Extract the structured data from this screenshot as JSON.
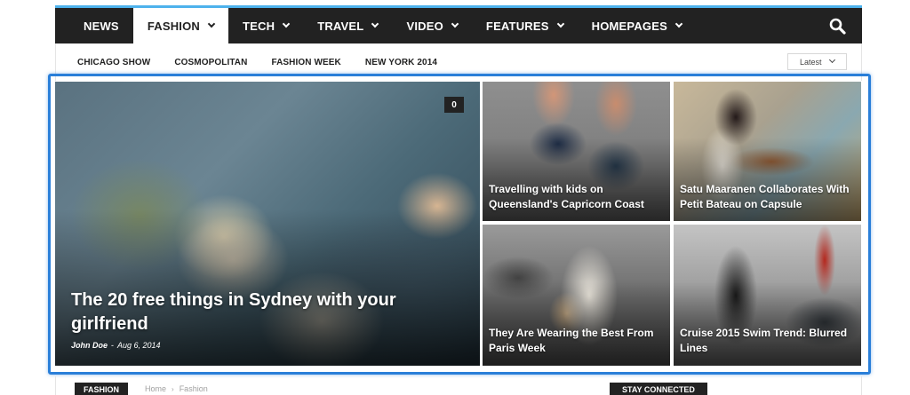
{
  "nav": {
    "items": [
      {
        "label": "NEWS",
        "has_dropdown": false,
        "active": false
      },
      {
        "label": "FASHION",
        "has_dropdown": true,
        "active": true
      },
      {
        "label": "TECH",
        "has_dropdown": true,
        "active": false
      },
      {
        "label": "TRAVEL",
        "has_dropdown": true,
        "active": false
      },
      {
        "label": "VIDEO",
        "has_dropdown": true,
        "active": false
      },
      {
        "label": "FEATURES",
        "has_dropdown": true,
        "active": false
      },
      {
        "label": "HOMEPAGES",
        "has_dropdown": true,
        "active": false
      }
    ],
    "search_icon": "search-icon",
    "colors": {
      "bar": "#222222",
      "accent": "#4db2ec"
    }
  },
  "subnav": {
    "items": [
      "CHICAGO SHOW",
      "COSMOPOLITAN",
      "FASHION WEEK",
      "NEW YORK 2014"
    ],
    "sort": {
      "selected": "Latest"
    }
  },
  "featured": {
    "main": {
      "title": "The 20 free things in Sydney with your girlfriend",
      "author": "John Doe",
      "separator": "-",
      "date": "Aug 6, 2014",
      "comments": "0"
    },
    "tiles": [
      {
        "title": "Travelling with kids on Queensland's Capricorn Coast"
      },
      {
        "title": "Satu Maaranen Collaborates With Petit Bateau on Capsule"
      },
      {
        "title": "They Are Wearing the Best From Paris Week"
      },
      {
        "title": "Cruise 2015 Swim Trend: Blurred Lines"
      }
    ],
    "highlight_color": "#2a7fd9"
  },
  "bottom": {
    "category": "FASHION",
    "breadcrumb": [
      "Home",
      "Fashion"
    ],
    "sidebar_heading": "STAY CONNECTED"
  }
}
